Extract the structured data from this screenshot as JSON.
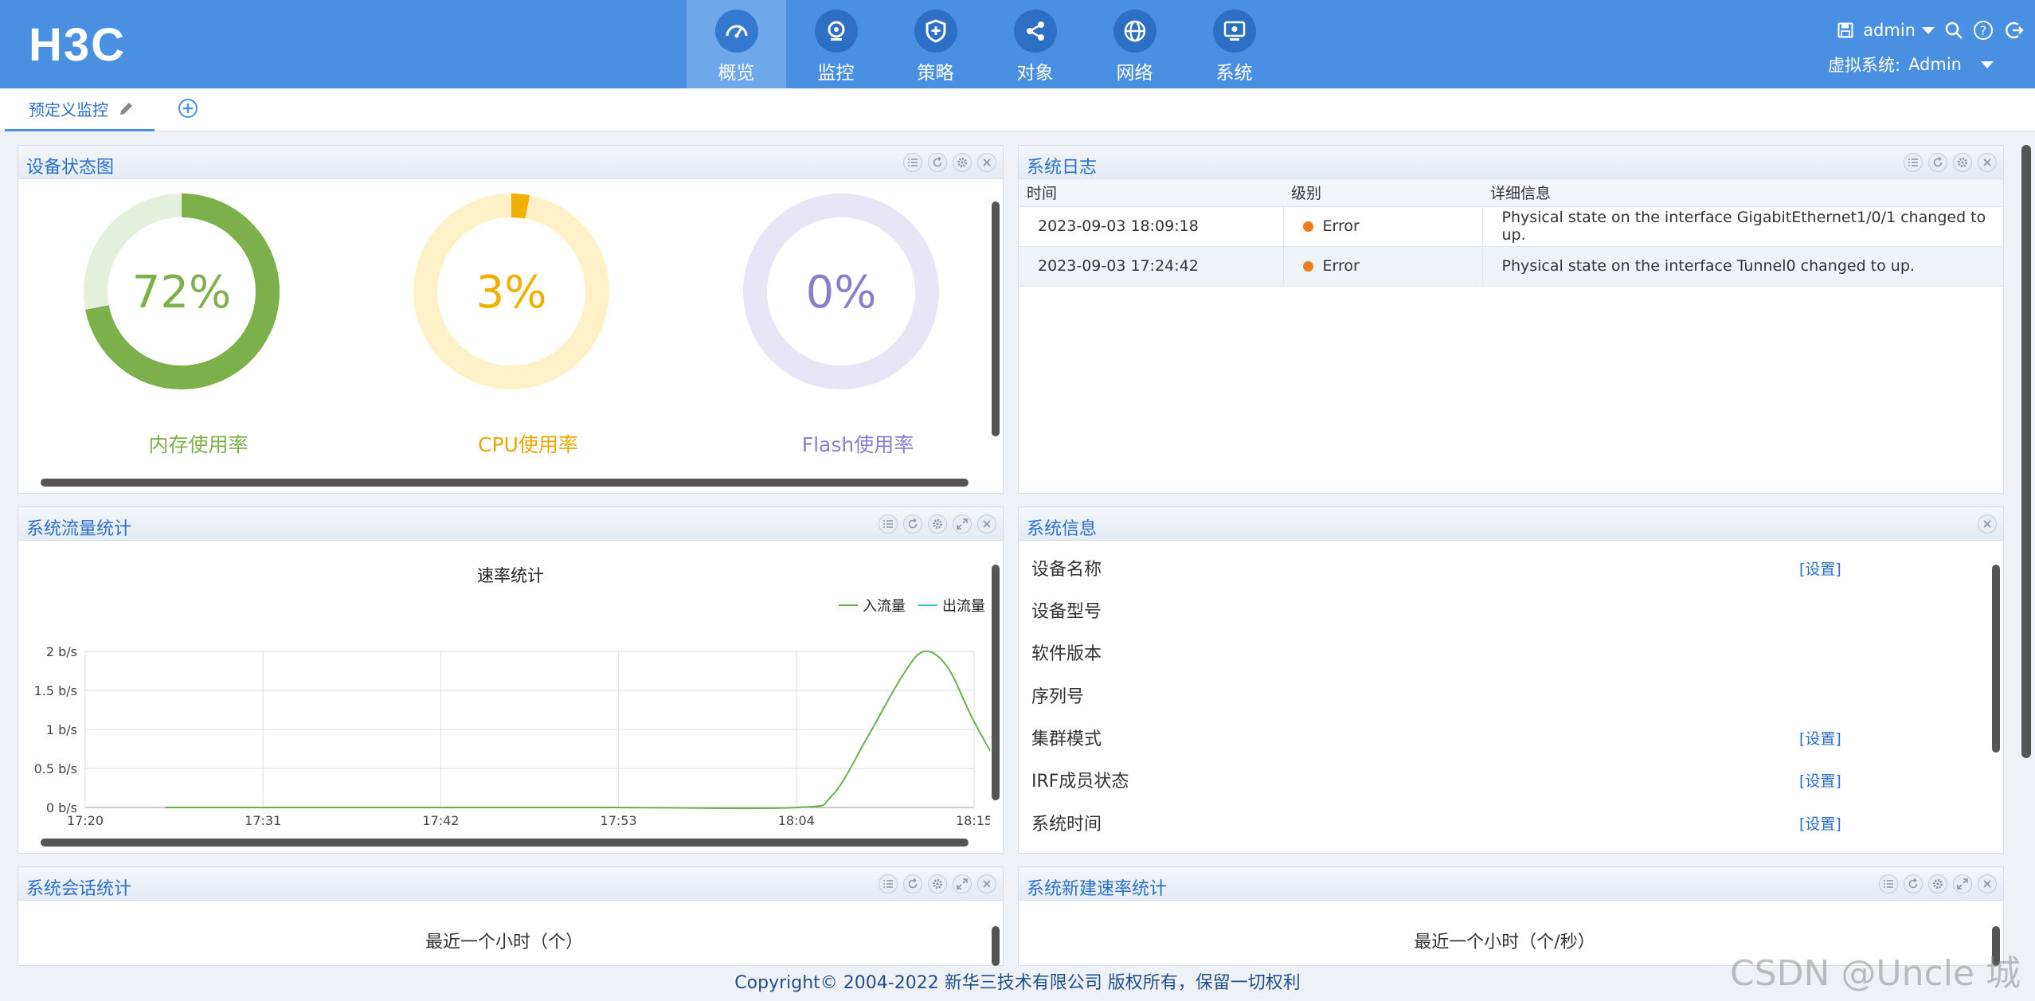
{
  "brand": {
    "logo_text": "H3C"
  },
  "nav": {
    "items": [
      {
        "label": "概览",
        "icon": "dashboard-icon",
        "active": true
      },
      {
        "label": "监控",
        "icon": "camera-icon",
        "active": false
      },
      {
        "label": "策略",
        "icon": "shield-icon",
        "active": false
      },
      {
        "label": "对象",
        "icon": "share-icon",
        "active": false
      },
      {
        "label": "网络",
        "icon": "globe-icon",
        "active": false
      },
      {
        "label": "系统",
        "icon": "monitor-icon",
        "active": false
      }
    ]
  },
  "header": {
    "user": "admin",
    "vsys_label": "虚拟系统:",
    "vsys_value": "Admin"
  },
  "tabs": [
    {
      "label": "预定义监控"
    }
  ],
  "panels": {
    "device_status": {
      "title": "设备状态图",
      "gauges": [
        {
          "label": "内存使用率",
          "value_text": "72%",
          "value": 72,
          "color": "#7cb04b",
          "track": "#e4f0dc"
        },
        {
          "label": "CPU使用率",
          "value_text": "3%",
          "value": 3,
          "color": "#f0b000",
          "track": "#fff1c7"
        },
        {
          "label": "Flash使用率",
          "value_text": "0%",
          "value": 0,
          "color": "#8b7ccf",
          "track": "#e8e5f6"
        }
      ]
    },
    "syslog": {
      "title": "系统日志",
      "columns": [
        "时间",
        "级别",
        "详细信息"
      ],
      "rows": [
        {
          "time": "2023-09-03 18:09:18",
          "level": "Error",
          "detail": "Physical state on the interface GigabitEthernet1/0/1 changed to up."
        },
        {
          "time": "2023-09-03 17:24:42",
          "level": "Error",
          "detail": "Physical state on the interface Tunnel0 changed to up."
        }
      ]
    },
    "traffic": {
      "title": "系统流量统计"
    },
    "sysinfo": {
      "title": "系统信息",
      "rows": [
        {
          "label": "设备名称",
          "link": "[设置]"
        },
        {
          "label": "设备型号",
          "link": ""
        },
        {
          "label": "软件版本",
          "link": ""
        },
        {
          "label": "序列号",
          "link": ""
        },
        {
          "label": "集群模式",
          "link": "[设置]"
        },
        {
          "label": "IRF成员状态",
          "link": "[设置]"
        },
        {
          "label": "系统时间",
          "link": "[设置]"
        }
      ]
    },
    "sessions": {
      "title": "系统会话统计",
      "subtitle": "最近一个小时（个）"
    },
    "new_rate": {
      "title": "系统新建速率统计",
      "subtitle": "最近一个小时（个/秒）"
    }
  },
  "chart_data": {
    "type": "line",
    "title": "速率统计",
    "x": [
      "17:20",
      "17:31",
      "17:42",
      "17:53",
      "18:04",
      "18:15"
    ],
    "xlabel": "",
    "ylabel": "",
    "y_ticks": [
      "0 b/s",
      "0.5 b/s",
      "1 b/s",
      "1.5 b/s",
      "2 b/s"
    ],
    "ylim": [
      0,
      2
    ],
    "legend_position": "top-right",
    "series": [
      {
        "name": "入流量",
        "color": "#6ab04c",
        "points": [
          [
            0.45,
            0
          ],
          [
            2,
            0
          ],
          [
            3,
            0
          ],
          [
            4,
            0
          ],
          [
            4.2,
            0.15
          ],
          [
            4.4,
            0.9
          ],
          [
            4.6,
            1.7
          ],
          [
            4.72,
            2.0
          ],
          [
            4.85,
            1.8
          ],
          [
            5,
            1.1
          ],
          [
            5.2,
            0.3
          ],
          [
            5.3,
            0
          ]
        ]
      },
      {
        "name": "出流量",
        "color": "#3fc1e0",
        "points": []
      }
    ]
  },
  "footer": {
    "copyright": "Copyright© 2004-2022 新华三技术有限公司 版权所有，保留一切权利"
  },
  "watermark": "CSDN @Uncle 城"
}
